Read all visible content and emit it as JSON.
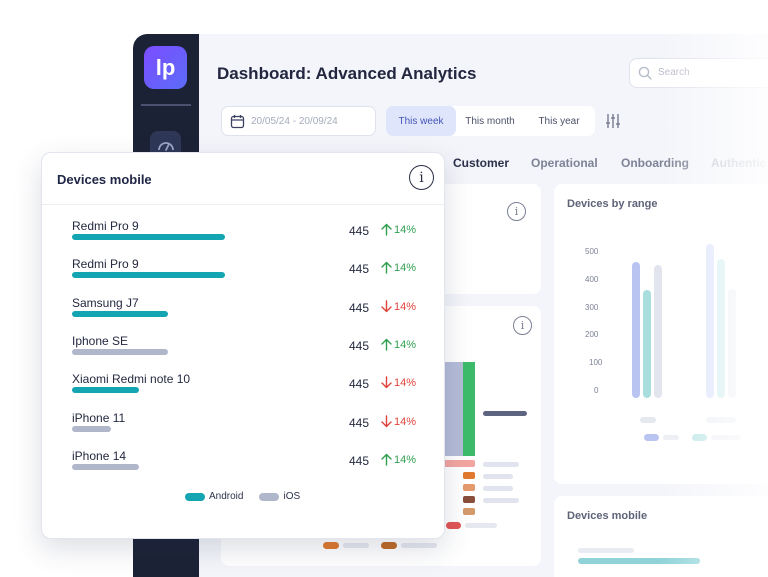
{
  "app": {
    "logo": "lp",
    "title": "Dashboard: Advanced Analytics",
    "search_placeholder": "Search"
  },
  "filters": {
    "date_range": "20/05/24 - 20/09/24",
    "periods": [
      {
        "label": "This week",
        "active": true
      },
      {
        "label": "This month",
        "active": false
      },
      {
        "label": "This year",
        "active": false
      }
    ]
  },
  "tabs": [
    "Customer",
    "Operational",
    "Onboarding",
    "Authentic"
  ],
  "background_cards": {
    "range_title": "Devices by range",
    "range_axis": [
      "500",
      "400",
      "300",
      "200",
      "100",
      "0"
    ],
    "mobile_title": "Devices mobile"
  },
  "colors": {
    "android": "#14a5b2",
    "ios": "#b1b7cb",
    "up": "#2e9f4f",
    "down": "#e0433a",
    "accent": "#6c5cf5"
  },
  "popup": {
    "title": "Devices mobile",
    "info_icon": "info-icon",
    "devices": [
      {
        "name": "Redmi Pro 9",
        "platform": "android",
        "share": 0.43,
        "count": "445",
        "trend": "up",
        "change": "14%"
      },
      {
        "name": "Redmi Pro 9",
        "platform": "android",
        "share": 0.43,
        "count": "445",
        "trend": "up",
        "change": "14%"
      },
      {
        "name": "Samsung J7",
        "platform": "android",
        "share": 0.27,
        "count": "445",
        "trend": "down",
        "change": "14%"
      },
      {
        "name": "Iphone SE",
        "platform": "ios",
        "share": 0.27,
        "count": "445",
        "trend": "up",
        "change": "14%"
      },
      {
        "name": "Xiaomi Redmi note 10",
        "platform": "android",
        "share": 0.19,
        "count": "445",
        "trend": "down",
        "change": "14%"
      },
      {
        "name": "iPhone 11",
        "platform": "ios",
        "share": 0.11,
        "count": "445",
        "trend": "down",
        "change": "14%"
      },
      {
        "name": "iPhone 14",
        "platform": "ios",
        "share": 0.19,
        "count": "445",
        "trend": "up",
        "change": "14%"
      }
    ],
    "legend": [
      {
        "label": "Android",
        "color": "#14a5b2"
      },
      {
        "label": "iOS",
        "color": "#b1b7cb"
      }
    ]
  }
}
